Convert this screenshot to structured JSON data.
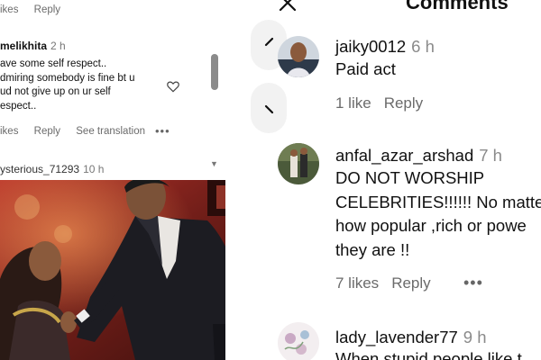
{
  "left_comments": {
    "top_actions": {
      "likes": "ikes",
      "reply": "Reply"
    },
    "comment": {
      "username": "melikhita",
      "time": "2 h",
      "text": "ave some self respect..\ndmiring somebody is fine bt u\nud not give up on ur self\nespect..",
      "actions": {
        "likes": "ikes",
        "reply": "Reply",
        "translate": "See translation",
        "more": "•••"
      }
    },
    "next_comment": {
      "username": "ysterious_71293",
      "time": "10 h"
    }
  },
  "right_comments": {
    "title": "Comments",
    "comments": [
      {
        "username": "jaiky0012",
        "time": "6 h",
        "text": "Paid act",
        "actions": {
          "likes": "1 like",
          "reply": "Reply"
        }
      },
      {
        "username": "anfal_azar_arshad",
        "time": "7 h",
        "text": "DO NOT WORSHIP\nCELEBRITIES!!!!!! No matte\nhow popular ,rich or powe\nthey are !!",
        "actions": {
          "likes": "7 likes",
          "reply": "Reply",
          "more": "•••"
        }
      },
      {
        "username": "lady_lavender77",
        "time": "9 h",
        "text": "When stupid people like t"
      }
    ]
  },
  "colors": {
    "meta_gray": "#6b6b6b",
    "text": "#111111",
    "stage_red": "#7a1f18"
  }
}
